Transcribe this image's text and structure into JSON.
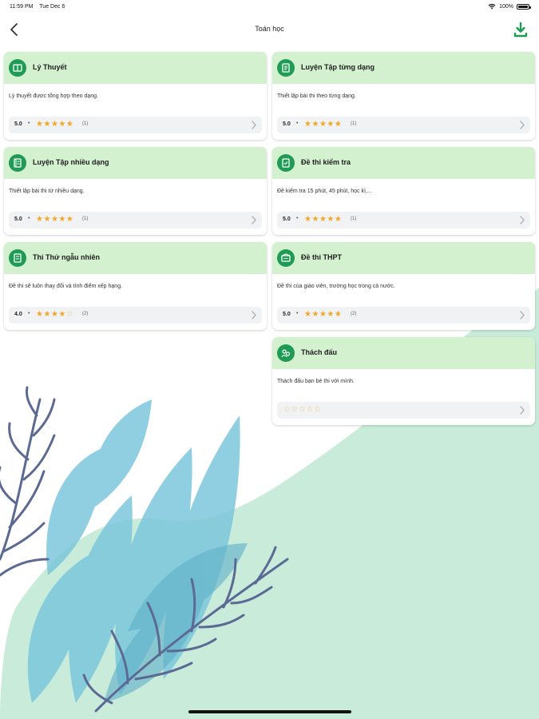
{
  "status_bar": {
    "time": "11:59 PM",
    "date": "Tue Dec 6",
    "battery": "100%",
    "icons": [
      "wifi-icon",
      "battery-icon"
    ]
  },
  "nav": {
    "title": "Toán học",
    "back_icon": "chevron-left-icon",
    "download_icon": "download-icon"
  },
  "colors": {
    "accent": "#1f9b55",
    "card_header": "#d3f0cf",
    "star": "#f5a623",
    "bg_mint": "#c8ebda",
    "leaf_blue": "#7cc7dc",
    "branch": "#5c6a93"
  },
  "cards": [
    {
      "title": "Lý Thuyết",
      "description": "Lý thuyết được tổng hợp theo dạng.",
      "score": "5.0",
      "stars": 5,
      "count": "(1)",
      "icon": "book-icon"
    },
    {
      "title": "Luyện Tập từng dạng",
      "description": "Thiết lập bài thi theo từng dạng.",
      "score": "5.0",
      "stars": 5,
      "count": "(1)",
      "icon": "document-icon"
    },
    {
      "title": "Luyện Tập nhiều dạng",
      "description": "Thiết lập bài thi từ nhiều dạng.",
      "score": "5.0",
      "stars": 5,
      "count": "(1)",
      "icon": "notebook-icon"
    },
    {
      "title": "Đề thi kiểm tra",
      "description": "Đề kiểm tra 15 phút, 45 phút, học kì,...",
      "score": "5.0",
      "stars": 5,
      "count": "(1)",
      "icon": "exam-icon"
    },
    {
      "title": "Thi Thử ngẫu nhiên",
      "description": "Đề thi sẽ luôn thay đổi và tính điểm xếp hạng.",
      "score": "4.0",
      "stars": 4,
      "count": "(2)",
      "icon": "random-exam-icon"
    },
    {
      "title": "Đề thi THPT",
      "description": "Đề thi của giáo viên, trường học trong cả nước.",
      "score": "5.0",
      "stars": 5,
      "count": "(2)",
      "icon": "school-exam-icon"
    },
    {
      "title": "Thách đấu",
      "description": "Thách đấu bạn bè thi với mình.",
      "score": "",
      "stars": 0,
      "count": "",
      "icon": "challenge-icon"
    }
  ]
}
